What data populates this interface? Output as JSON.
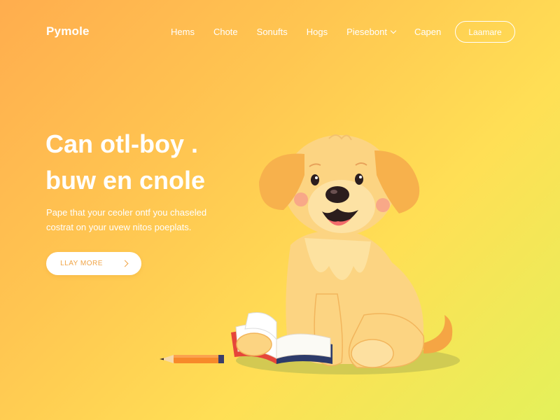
{
  "header": {
    "brand": "Pymole",
    "nav": [
      {
        "label": "Hems"
      },
      {
        "label": "Chote"
      },
      {
        "label": "Sonufts"
      },
      {
        "label": "Hogs"
      },
      {
        "label": "Piesebont",
        "has_dropdown": true
      },
      {
        "label": "Capen"
      }
    ],
    "cta_label": "Laamare"
  },
  "hero": {
    "title_lines": [
      "Can otl-boy .",
      "buw en cnole"
    ],
    "subtitle_lines": [
      "Pape that your ceoler ontf you chaseled",
      "costrat on your uvew nitos poeplats."
    ],
    "cta_label": "LLAY MORE"
  },
  "colors": {
    "gradient_start": "#ffad4e",
    "gradient_end": "#e4f15a",
    "accent": "#f0a446",
    "text": "#ffffff"
  },
  "icons": [
    "chevron-down-icon",
    "chevron-right-icon",
    "puppy-illustration",
    "book-illustration",
    "pencil-illustration"
  ]
}
